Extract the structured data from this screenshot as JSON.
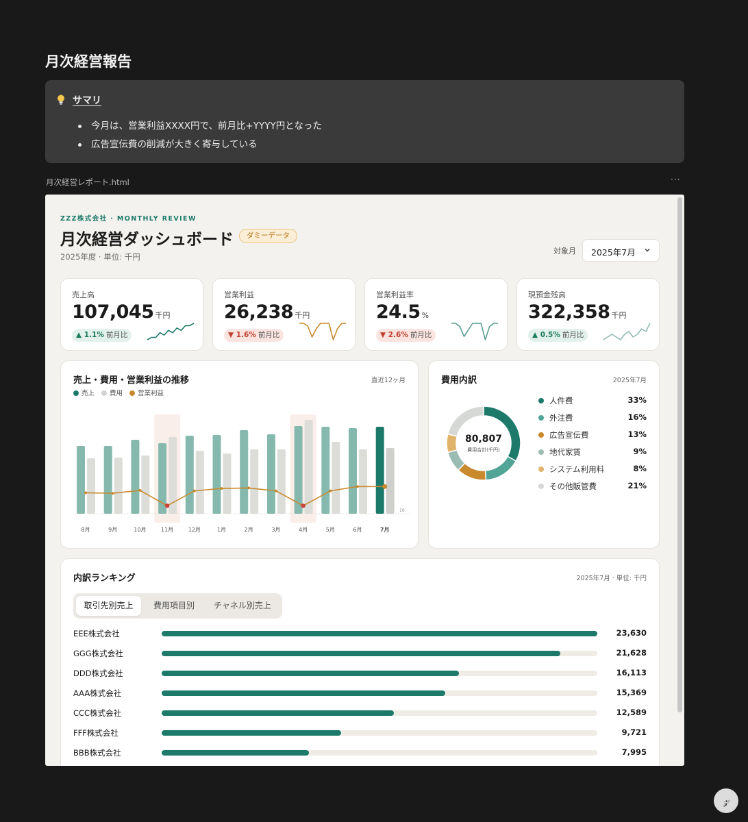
{
  "page": {
    "title": "月次経営報告"
  },
  "callout": {
    "icon": "lightbulb-icon",
    "heading": "サマリ",
    "bullets": [
      "今月は、営業利益XXXX円で、前月比+YYYY円となった",
      "広告宣伝費の削減が大きく寄与している"
    ]
  },
  "embed": {
    "filename": "月次経営レポート.html",
    "menu": "···"
  },
  "dashboard": {
    "brand": "ZZZ株式会社 · MONTHLY REVIEW",
    "title": "月次経営ダッシュボード",
    "badge": "ダミーデータ",
    "subtitle": "2025年度 · 単位: 千円",
    "month_label": "対象月",
    "month_value": "2025年7月",
    "kpis": [
      {
        "label": "売上高",
        "value": "107,045",
        "unit": "千円",
        "delta_arrow": "▲",
        "delta": "1.1%",
        "compare": "前月比",
        "direction": "up",
        "spark_color": "#1d7a6b",
        "spark": [
          2,
          3,
          3,
          5,
          4,
          6,
          5,
          7,
          6,
          8,
          8,
          9
        ]
      },
      {
        "label": "営業利益",
        "value": "26,238",
        "unit": "千円",
        "delta_arrow": "▼",
        "delta": "1.6%",
        "compare": "前月比",
        "direction": "down",
        "spark_color": "#c98a2e",
        "spark": [
          8,
          8,
          7,
          3,
          6,
          8,
          8,
          8,
          2,
          6,
          8,
          8
        ]
      },
      {
        "label": "営業利益率",
        "value": "24.5",
        "unit": "%",
        "delta_arrow": "▼",
        "delta": "2.6%",
        "compare": "前月比",
        "direction": "down",
        "spark_color": "#5a9e92",
        "spark": [
          8,
          8,
          7,
          4,
          6,
          8,
          8,
          8,
          3,
          7,
          8,
          8
        ]
      },
      {
        "label": "現預金残高",
        "value": "322,358",
        "unit": "千円",
        "delta_arrow": "▲",
        "delta": "0.5%",
        "compare": "前月比",
        "direction": "up",
        "spark_color": "#8fbab2",
        "spark": [
          3,
          4,
          5,
          4,
          3,
          5,
          6,
          4,
          5,
          7,
          6,
          9
        ]
      }
    ],
    "trend": {
      "title": "売上・費用・営業利益の推移",
      "note": "直近12ヶ月",
      "legend": [
        {
          "name": "売上",
          "color": "#1d7a6b"
        },
        {
          "name": "費用",
          "color": "#d3d3d0"
        },
        {
          "name": "営業利益",
          "color": "#c98a2e"
        }
      ]
    },
    "expense": {
      "title": "費用内訳",
      "note": "2025年7月",
      "total": "80,807",
      "total_label": "費用合計(千円)",
      "items": [
        {
          "name": "人件費",
          "pct": "33%",
          "share": 33,
          "color": "#1d7a6b"
        },
        {
          "name": "外注費",
          "pct": "16%",
          "share": 16,
          "color": "#52a596"
        },
        {
          "name": "広告宣伝費",
          "pct": "13%",
          "share": 13,
          "color": "#c98a2e"
        },
        {
          "name": "地代家賃",
          "pct": "9%",
          "share": 9,
          "color": "#9bbcb3"
        },
        {
          "name": "システム利用料",
          "pct": "8%",
          "share": 8,
          "color": "#e0b46c"
        },
        {
          "name": "その他販管費",
          "pct": "21%",
          "share": 21,
          "color": "#d5d8d4"
        }
      ]
    },
    "ranking": {
      "title": "内訳ランキング",
      "note": "2025年7月 · 単位: 千円",
      "tabs": [
        "取引先別売上",
        "費用項目別",
        "チャネル別売上"
      ],
      "active_tab": 0,
      "rows": [
        {
          "name": "EEE株式会社",
          "value": "23,630",
          "amount": 23630
        },
        {
          "name": "GGG株式会社",
          "value": "21,628",
          "amount": 21628
        },
        {
          "name": "DDD株式会社",
          "value": "16,113",
          "amount": 16113
        },
        {
          "name": "AAA株式会社",
          "value": "15,369",
          "amount": 15369
        },
        {
          "name": "CCC株式会社",
          "value": "12,589",
          "amount": 12589
        },
        {
          "name": "FFF株式会社",
          "value": "9,721",
          "amount": 9721
        },
        {
          "name": "BBB株式会社",
          "value": "7,995",
          "amount": 7995
        }
      ]
    }
  },
  "chart_data": {
    "type": "bar",
    "categories": [
      "8月",
      "9月",
      "10月",
      "11月",
      "12月",
      "1月",
      "2月",
      "3月",
      "4月",
      "5月",
      "6月",
      "7月"
    ],
    "series": [
      {
        "name": "売上",
        "values": [
          99,
          99,
          108,
          103,
          114,
          115,
          122,
          116,
          128,
          127,
          125,
          127
        ]
      },
      {
        "name": "費用",
        "values": [
          81,
          82,
          85,
          112,
          92,
          88,
          94,
          94,
          137,
          105,
          94,
          96
        ]
      },
      {
        "name": "営業利益",
        "values": [
          18,
          17,
          23,
          -9,
          22,
          27,
          28,
          22,
          -9,
          22,
          31,
          31
        ]
      }
    ],
    "highlight": [
      "11月",
      "4月"
    ],
    "axis_label": "10",
    "legend_position": "top-left"
  },
  "ui": {
    "help_icon": "help-icon",
    "help_glyph": "𝓏"
  }
}
